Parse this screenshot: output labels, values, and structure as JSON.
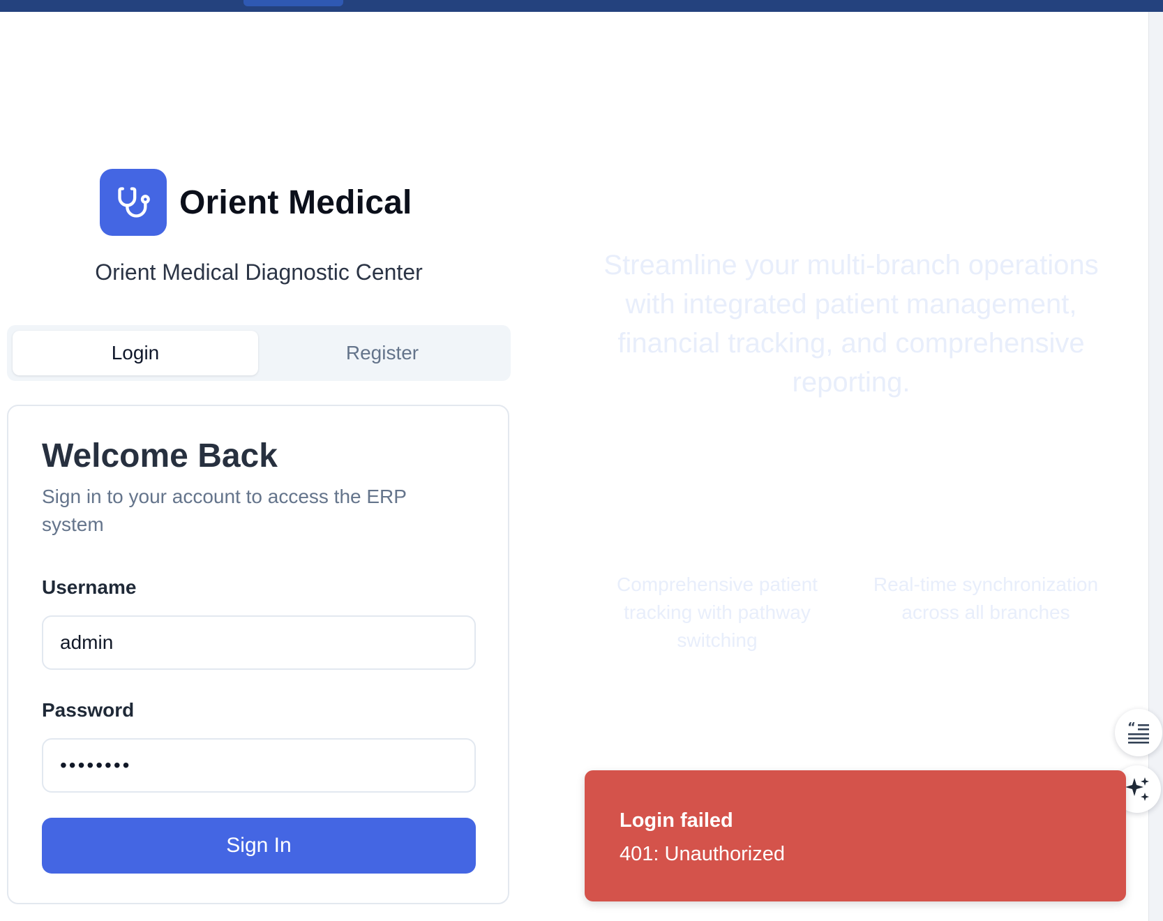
{
  "brand": {
    "name": "Orient Medical",
    "subtitle": "Orient Medical Diagnostic Center",
    "logo_icon": "stethoscope-icon",
    "accent_color": "#4466e3"
  },
  "tabs": [
    {
      "label": "Login",
      "active": true
    },
    {
      "label": "Register",
      "active": false
    }
  ],
  "login_card": {
    "title": "Welcome Back",
    "description": "Sign in to your account to access the ERP system",
    "username_label": "Username",
    "username_value": "admin",
    "password_label": "Password",
    "password_value": "password",
    "submit_label": "Sign In"
  },
  "marketing": {
    "tagline": "Streamline your multi-branch operations with integrated patient management, financial tracking, and comprehensive reporting.",
    "features": [
      "Comprehensive patient tracking with pathway switching",
      "Real-time synchronization across all branches"
    ]
  },
  "floating_buttons": [
    {
      "icon": "quote-lines-icon"
    },
    {
      "icon": "sparkle-icon"
    }
  ],
  "toast": {
    "title": "Login failed",
    "message": "401: Unauthorized",
    "color": "#d4534b"
  }
}
